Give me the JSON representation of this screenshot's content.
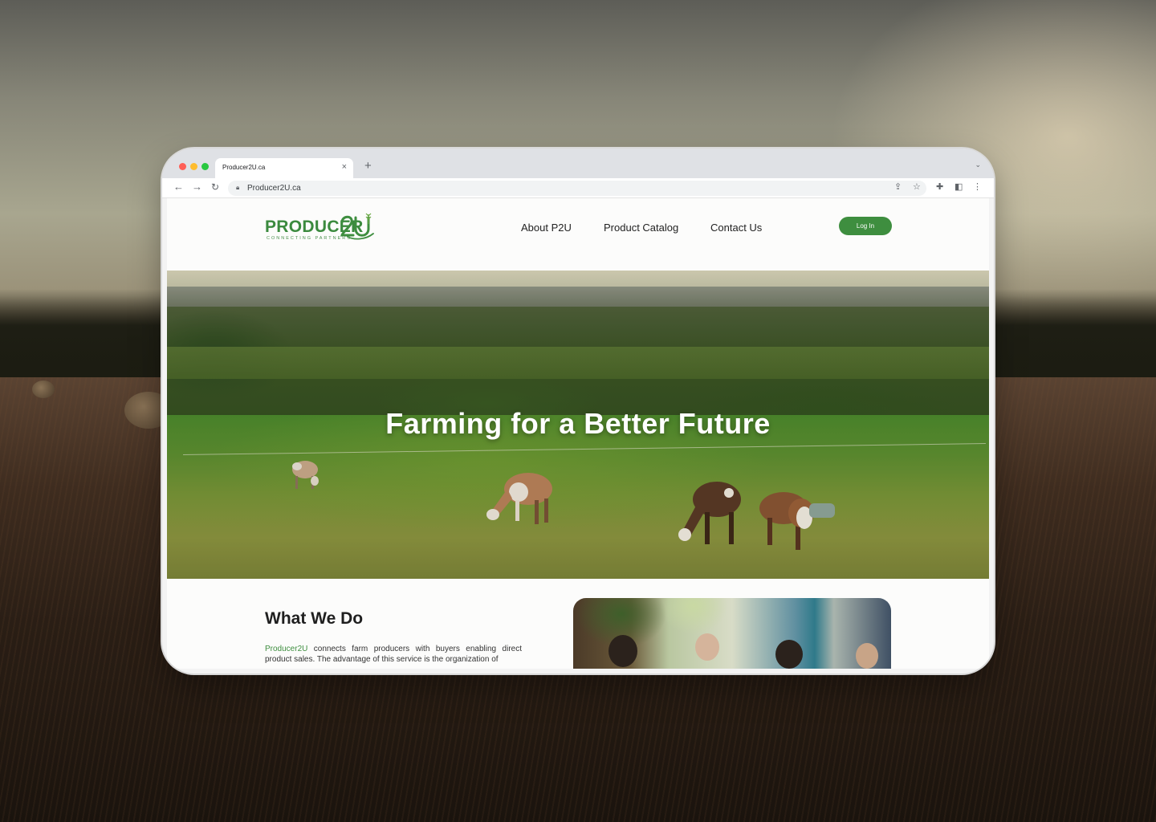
{
  "browser": {
    "tab_title": "Producer2U.ca",
    "tab_close": "×",
    "new_tab": "+",
    "tab_menu": "⌄",
    "url": "Producer2U.ca"
  },
  "site": {
    "logo": {
      "word": "PRODUCER",
      "mark": "2U",
      "tagline": "CONNECTING PARTNERS"
    },
    "nav": [
      {
        "label": "About P2U"
      },
      {
        "label": "Product Catalog"
      },
      {
        "label": "Contact Us"
      }
    ],
    "login_label": "Log In",
    "brand_color": "#3e8e3f"
  },
  "hero": {
    "title": "Farming for a Better Future"
  },
  "what_we_do": {
    "title": "What We Do",
    "brand_name": "Producer2U",
    "text": " connects farm producers with buyers enabling direct product sales. The advantage of this service is the organization of"
  }
}
